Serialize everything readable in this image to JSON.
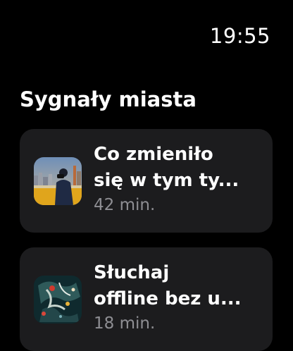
{
  "status_bar": {
    "time": "19:55"
  },
  "section": {
    "title": "Sygnały miasta"
  },
  "items": [
    {
      "title_line1": "Co zmieniło",
      "title_line2": "się w tym ty...",
      "duration": "42 min.",
      "thumbnail_icon": "city-photo-thumbnail"
    },
    {
      "title_line1": "Słuchaj",
      "title_line2": "offline bez u...",
      "duration": "18 min.",
      "thumbnail_icon": "abstract-map-thumbnail"
    }
  ],
  "colors": {
    "background": "#000000",
    "card": "#1c1c1e",
    "secondary_text": "#8e8e93"
  }
}
